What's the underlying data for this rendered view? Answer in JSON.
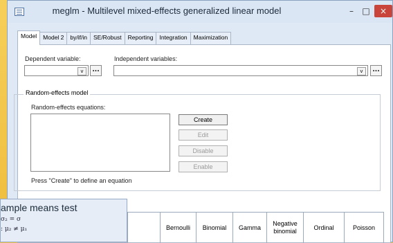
{
  "window": {
    "title": "meglm - Multilevel mixed-effects generalized linear model",
    "min_label": "–",
    "max_label": "□",
    "close_label": "×"
  },
  "tabs": [
    {
      "label": "Model",
      "active": true
    },
    {
      "label": "Model 2"
    },
    {
      "label": "by/if/in"
    },
    {
      "label": "SE/Robust"
    },
    {
      "label": "Reporting"
    },
    {
      "label": "Integration"
    },
    {
      "label": "Maximization"
    }
  ],
  "model": {
    "dependent_label": "Dependent variable:",
    "independent_label": "Independent variables:",
    "dropdown_arrow": "v",
    "ellipsis": "...",
    "random_group_title": "Random-effects model",
    "equations_label": "Random-effects equations:",
    "buttons": {
      "create": "Create",
      "edit": "Edit",
      "disable": "Disable",
      "enable": "Enable"
    },
    "hint": "Press \"Create\" to define an equation"
  },
  "overlay": {
    "title": "ample means test",
    "line1": "σ₂ = σ",
    "line2": ": μ₂ ≠ μ₁"
  },
  "family_table": {
    "columns": [
      "Bernoulli",
      "Binomial",
      "Gamma",
      "Negative binomial",
      "Ordinal",
      "Poisson"
    ]
  }
}
